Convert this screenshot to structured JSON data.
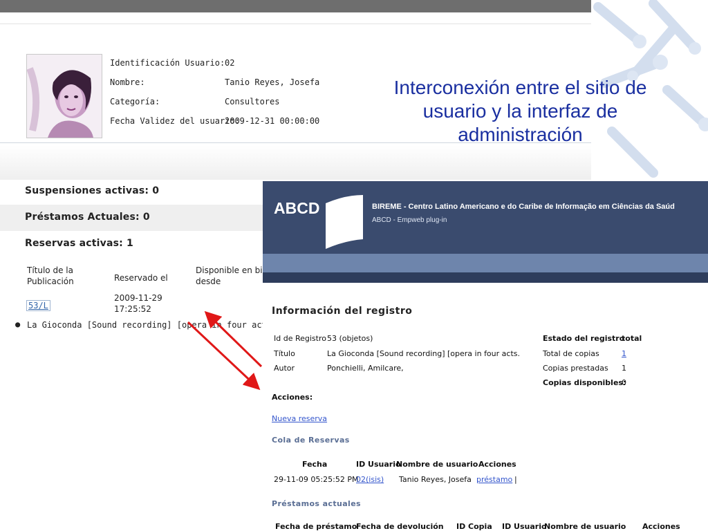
{
  "slide_title": "Interconexión entre el sitio de usuario y la interfaz de administración",
  "user_panel": {
    "photo": "user-photo",
    "fields": [
      {
        "label": "Identificación Usuario:",
        "value": "02"
      },
      {
        "label": "Nombre:",
        "value": "Tanio Reyes, Josefa"
      },
      {
        "label": "Categoría:",
        "value": "Consultores"
      },
      {
        "label": "Fecha Validez del usuario:",
        "value": "2009-12-31 00:00:00"
      }
    ]
  },
  "sections": {
    "suspensiones": "Suspensiones activas: 0",
    "prestamos": "Préstamos Actuales: 0",
    "reservas": "Reservas activas: 1"
  },
  "reservas_table": {
    "headers": [
      "Título de la Publicación",
      "Reservado el",
      "Disponible en bi desde"
    ],
    "row": {
      "link": "53/L",
      "date": "2009-11-29 17:25:52"
    },
    "bullet": "La Gioconda [Sound recording] [opera in four acts.Pon"
  },
  "admin": {
    "logo": "ABCD",
    "org": "BIREME - Centro Latino Americano e do Caribe de Informação em Ciências da Saúd",
    "subtitle": "ABCD - Empweb plug-in",
    "heading": "Información del registro",
    "left_fields": [
      {
        "label": "Id de Registro",
        "value": "53 (objetos)"
      },
      {
        "label": "Título",
        "value": "La Gioconda [Sound recording] [opera in four acts."
      },
      {
        "label": "Autor",
        "value": "Ponchielli, Amilcare,"
      }
    ],
    "estado_header": {
      "label": "Estado del registro",
      "value": "total"
    },
    "estado_rows": [
      {
        "label": "Total de copias",
        "value": "1"
      },
      {
        "label": "Copias prestadas",
        "value": "1"
      },
      {
        "label": "Copias disponibles:",
        "value": "0"
      }
    ],
    "acciones_label": "Acciones:",
    "nueva_reserva": "Nueva reserva",
    "cola_title": "Cola de Reservas",
    "cola_headers": [
      "Fecha",
      "ID Usuario",
      "Nombre de usuario",
      "Acciones"
    ],
    "cola_row": {
      "fecha": "29-11-09 05:25:52 PM",
      "id": "02(isis)",
      "nombre": "Tanio Reyes, Josefa",
      "accion": "préstamo",
      "sep": "|"
    },
    "prestamos_title": "Préstamos actuales",
    "prestamos_headers": [
      "Fecha de préstamo",
      "Fecha de devolución",
      "ID Copia",
      "ID Usuario",
      "Nombre de usuario",
      "Acciones"
    ]
  },
  "colors": {
    "title": "#1a2fa0",
    "header": "#3a4b6e",
    "stripe": "#6e85ac",
    "arrow": "#e01818",
    "link": "#3355cc"
  }
}
